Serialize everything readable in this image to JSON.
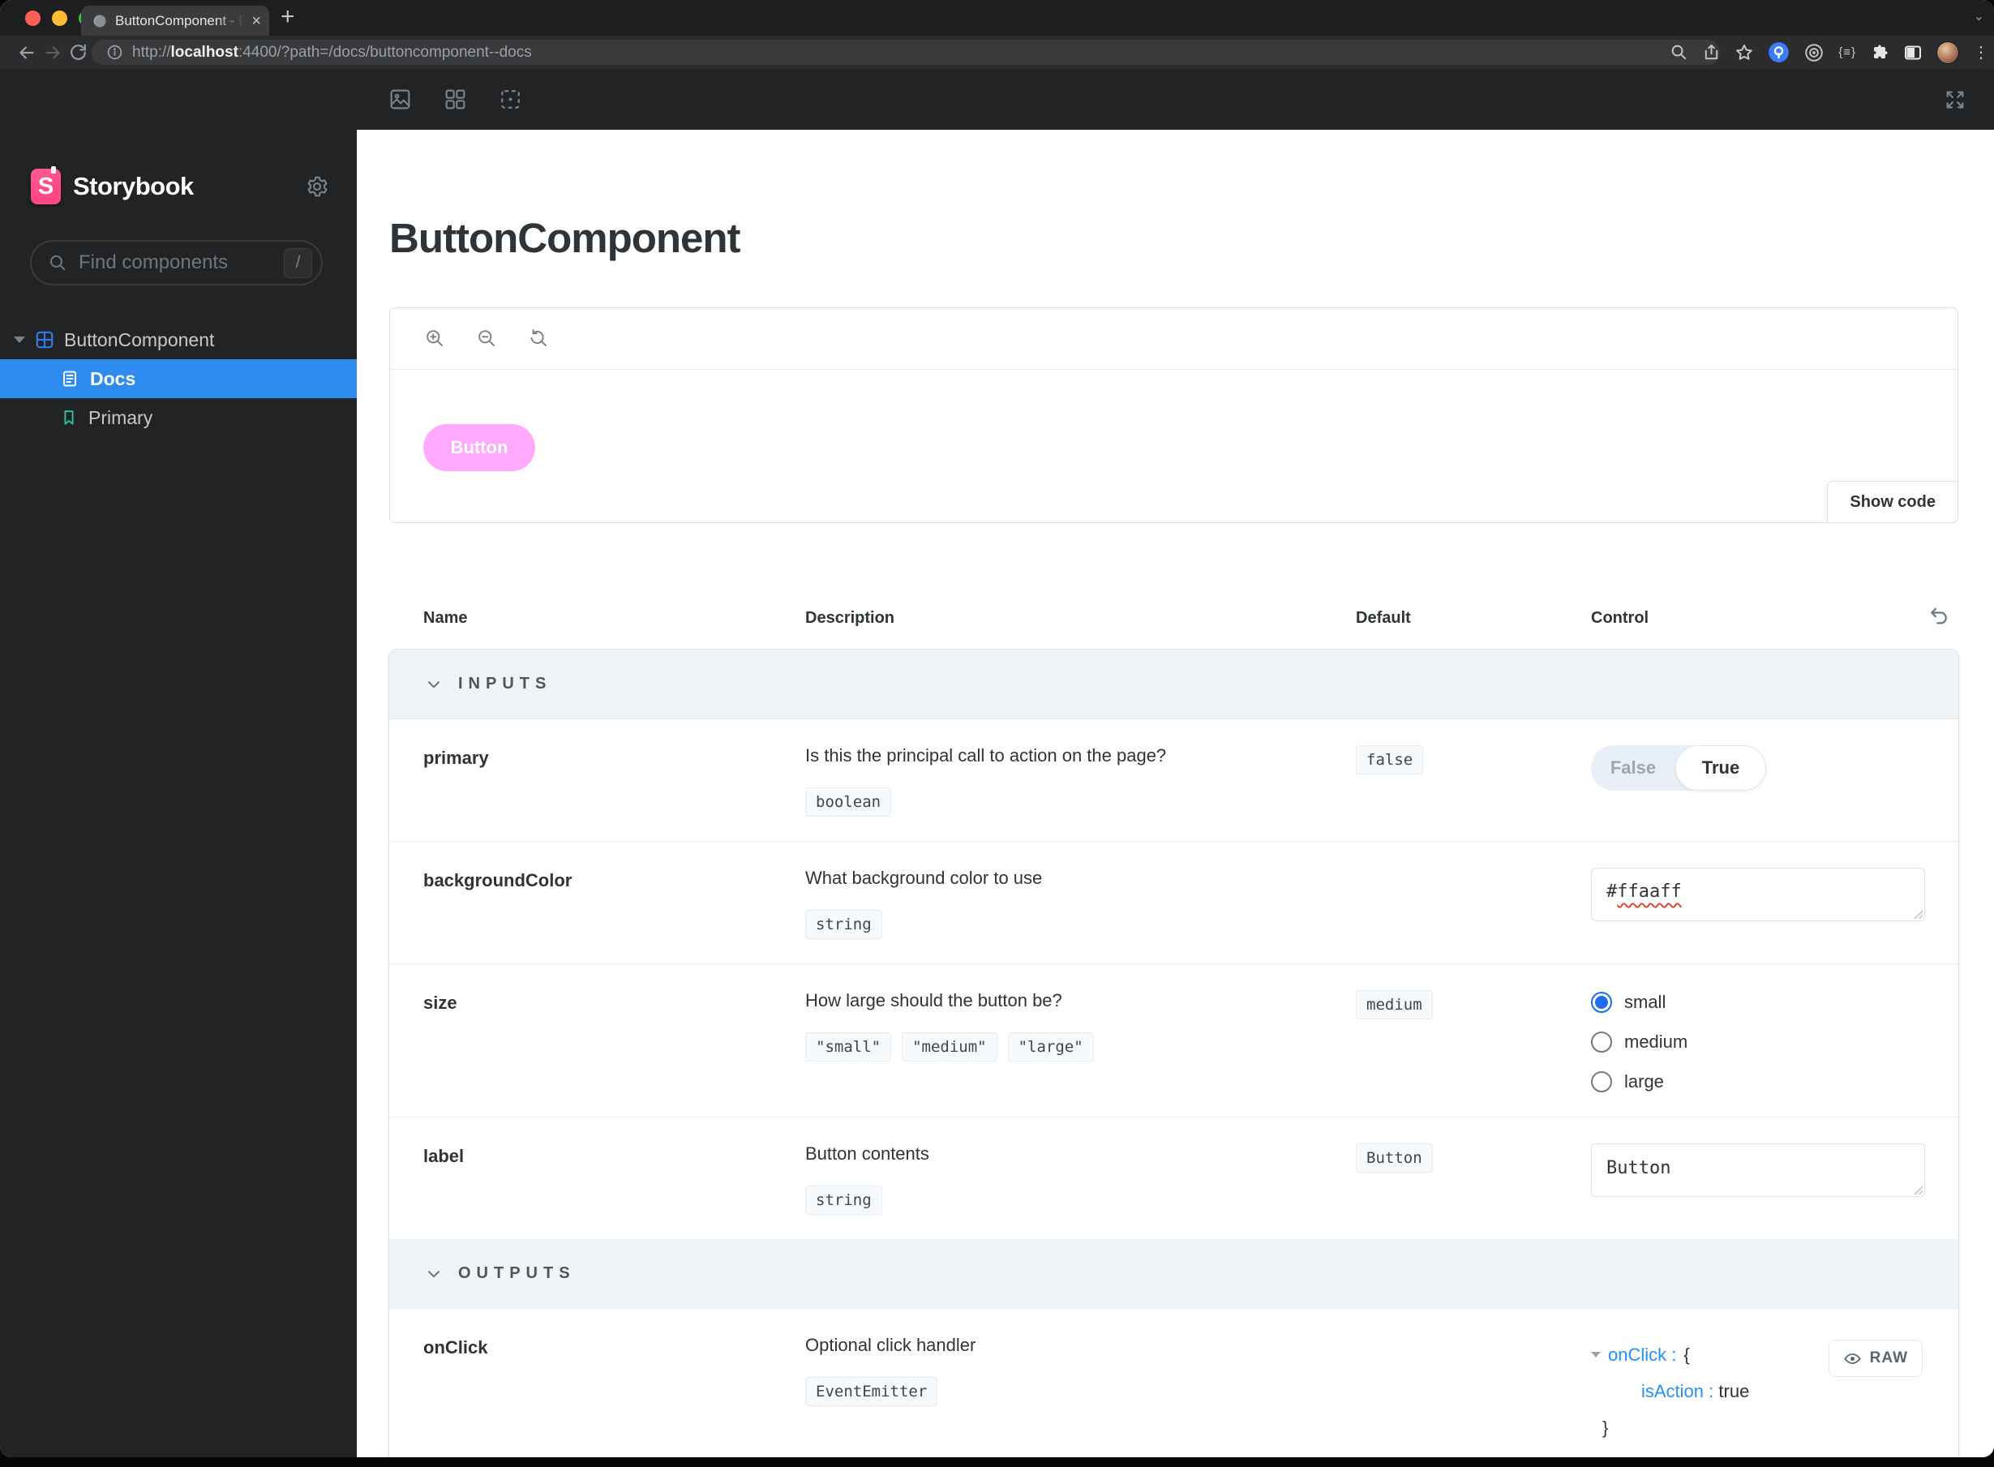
{
  "browser": {
    "tab": {
      "title": "ButtonComponent - Docs · Sto",
      "close_glyph": "×"
    },
    "new_tab_glyph": "+",
    "tabstrip_chevron_glyph": "⌄",
    "url": {
      "scheme": "http://",
      "host": "localhost",
      "rest": ":4400/?path=/docs/buttoncomponent--docs"
    },
    "braces_glyph": "{≡}",
    "overflow_glyph": "⋮"
  },
  "sidebar": {
    "brand": "Storybook",
    "brand_initial": "S",
    "search": {
      "placeholder": "Find components",
      "shortcut": "/"
    },
    "tree": {
      "component": "ButtonComponent",
      "docs": "Docs",
      "story": "Primary"
    }
  },
  "docs": {
    "title": "ButtonComponent",
    "preview": {
      "button_label": "Button",
      "show_code": "Show code"
    },
    "table": {
      "columns": {
        "name": "Name",
        "description": "Description",
        "default": "Default",
        "control": "Control"
      },
      "sections": {
        "inputs": "INPUTS",
        "outputs": "OUTPUTS"
      },
      "rows": {
        "primary": {
          "name": "primary",
          "description": "Is this the principal call to action on the page?",
          "type": "boolean",
          "default": "false",
          "toggle": {
            "off": "False",
            "on": "True"
          }
        },
        "background": {
          "name": "backgroundColor",
          "description": "What background color to use",
          "type": "string",
          "value_hash": "#",
          "value_rest": "ffaaff"
        },
        "size": {
          "name": "size",
          "description": "How large should the button be?",
          "types": [
            "\"small\"",
            "\"medium\"",
            "\"large\""
          ],
          "default": "medium",
          "options": [
            "small",
            "medium",
            "large"
          ],
          "selected": "small"
        },
        "label": {
          "name": "label",
          "description": "Button contents",
          "type": "string",
          "default": "Button",
          "value": "Button"
        },
        "onclick": {
          "name": "onClick",
          "description": "Optional click handler",
          "type": "EventEmitter",
          "tree": {
            "key": "onClick :",
            "open": "{",
            "child_key": "isAction :",
            "child_value": "true",
            "close": "}"
          },
          "raw": "RAW"
        }
      }
    }
  },
  "colors": {
    "selection_blue": "#2e8bf0",
    "brand_pink": "#ff4785",
    "story_button_pink": "#ffaaff",
    "bookmark_teal": "#2bc8a5",
    "link_blue": "#2492f5",
    "radio_blue": "#1b6ef0"
  }
}
